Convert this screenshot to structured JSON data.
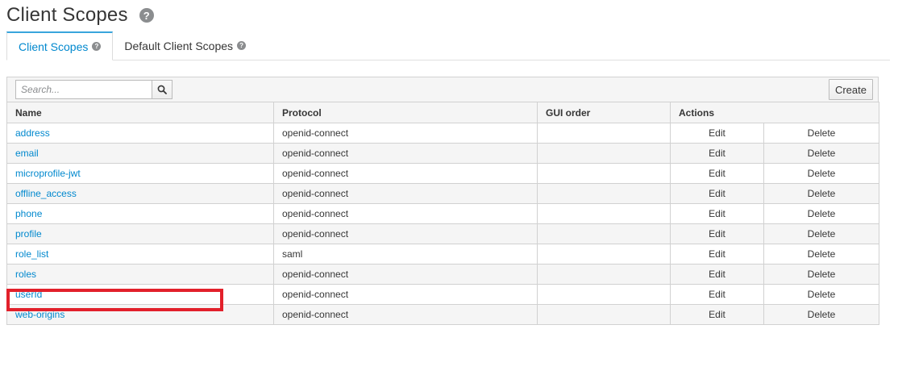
{
  "header": {
    "title": "Client Scopes",
    "help_glyph": "?"
  },
  "tabs": [
    {
      "label": "Client Scopes",
      "active": true
    },
    {
      "label": "Default Client Scopes",
      "active": false
    }
  ],
  "toolbar": {
    "search_placeholder": "Search...",
    "create_label": "Create"
  },
  "table": {
    "columns": [
      "Name",
      "Protocol",
      "GUI order",
      "Actions"
    ],
    "rows": [
      {
        "name": "address",
        "protocol": "openid-connect",
        "gui_order": "",
        "edit": "Edit",
        "delete": "Delete"
      },
      {
        "name": "email",
        "protocol": "openid-connect",
        "gui_order": "",
        "edit": "Edit",
        "delete": "Delete"
      },
      {
        "name": "microprofile-jwt",
        "protocol": "openid-connect",
        "gui_order": "",
        "edit": "Edit",
        "delete": "Delete"
      },
      {
        "name": "offline_access",
        "protocol": "openid-connect",
        "gui_order": "",
        "edit": "Edit",
        "delete": "Delete"
      },
      {
        "name": "phone",
        "protocol": "openid-connect",
        "gui_order": "",
        "edit": "Edit",
        "delete": "Delete"
      },
      {
        "name": "profile",
        "protocol": "openid-connect",
        "gui_order": "",
        "edit": "Edit",
        "delete": "Delete"
      },
      {
        "name": "role_list",
        "protocol": "saml",
        "gui_order": "",
        "edit": "Edit",
        "delete": "Delete"
      },
      {
        "name": "roles",
        "protocol": "openid-connect",
        "gui_order": "",
        "edit": "Edit",
        "delete": "Delete"
      },
      {
        "name": "userId",
        "protocol": "openid-connect",
        "gui_order": "",
        "edit": "Edit",
        "delete": "Delete"
      },
      {
        "name": "web-origins",
        "protocol": "openid-connect",
        "gui_order": "",
        "edit": "Edit",
        "delete": "Delete"
      }
    ]
  },
  "colors": {
    "link": "#0088ce",
    "highlight": "#e2202b",
    "tab_accent": "#39a5dc"
  },
  "icons": {
    "help": "question-circle-icon",
    "search": "search-icon"
  }
}
